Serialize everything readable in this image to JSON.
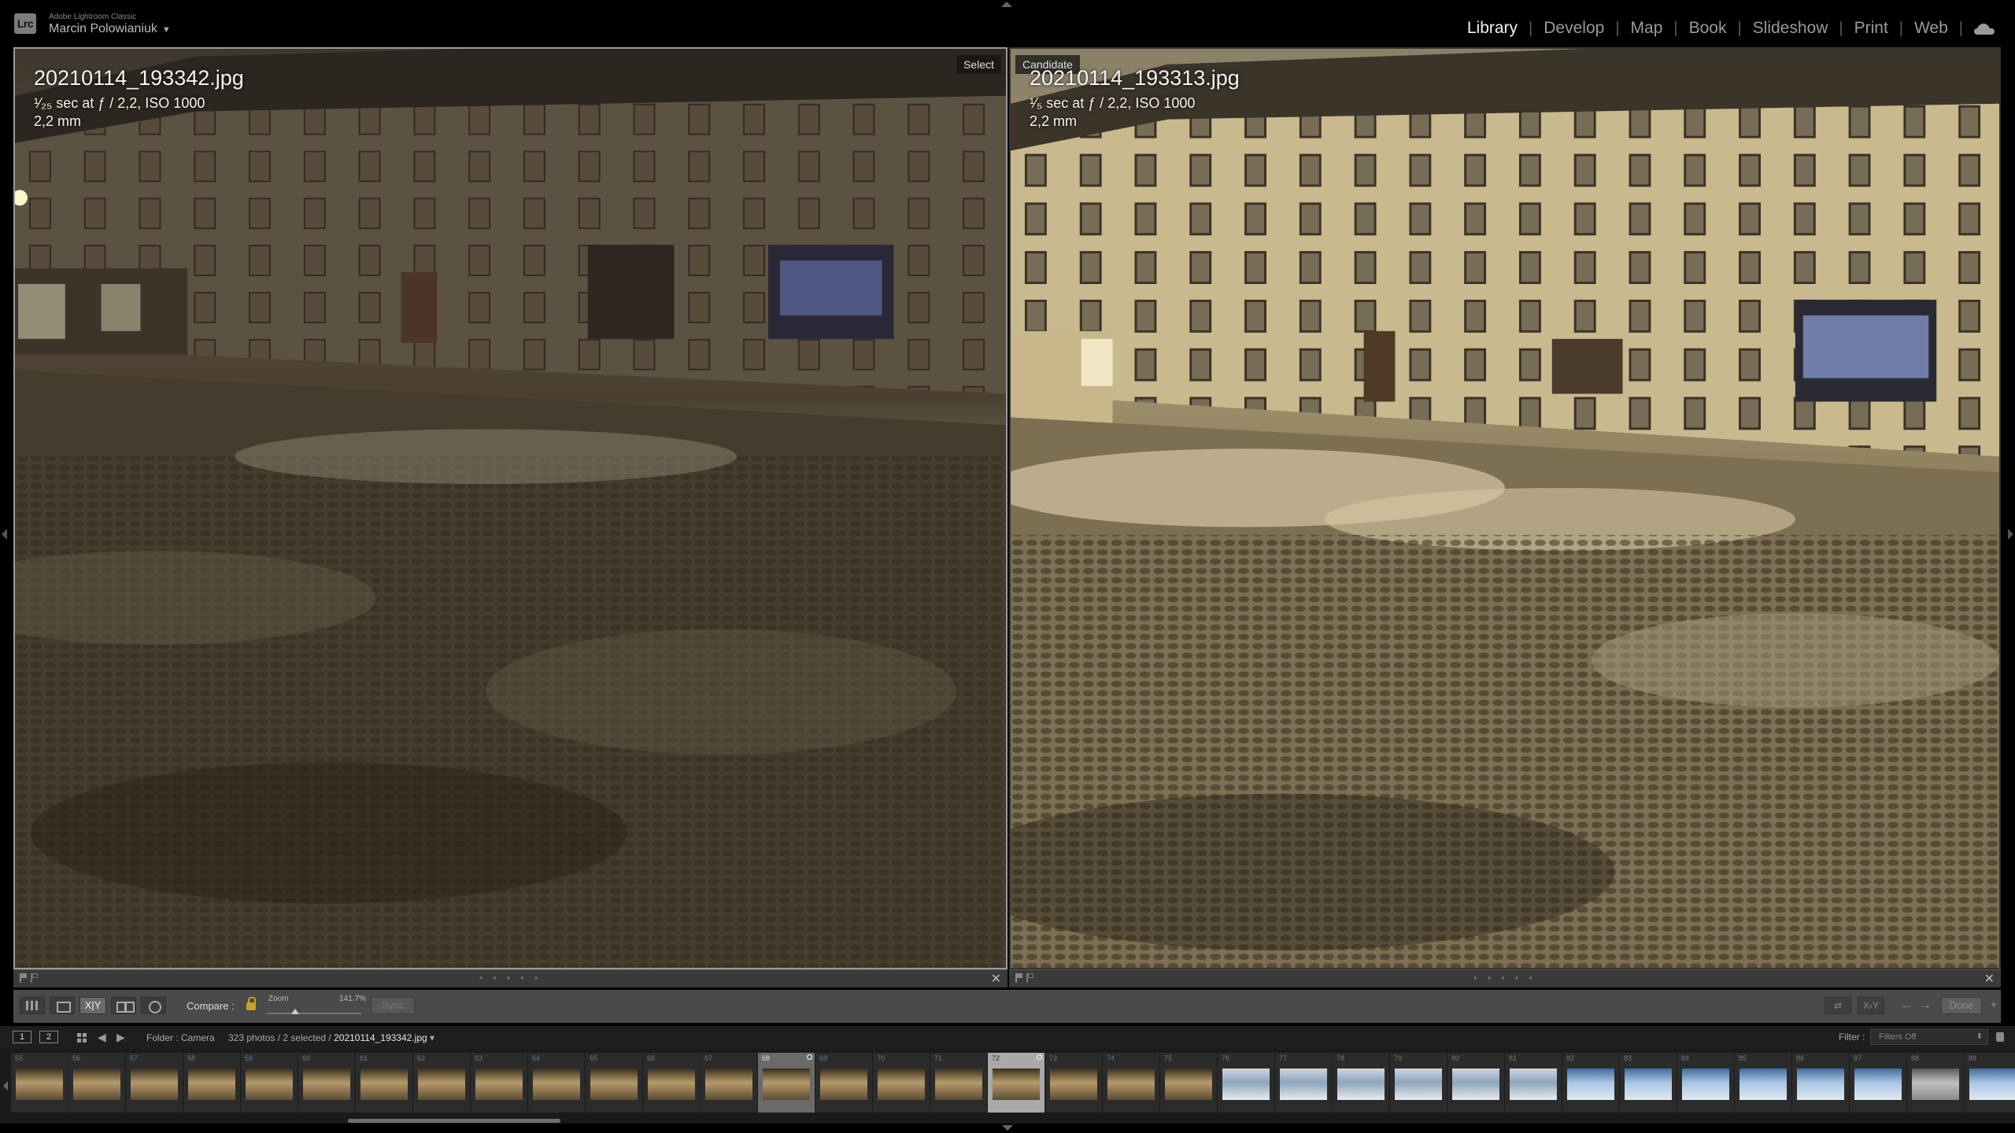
{
  "header": {
    "logo": "Lrc",
    "app_name": "Adobe Lightroom Classic",
    "user": "Marcin Polowianiuk",
    "modules": [
      {
        "label": "Library",
        "active": true
      },
      {
        "label": "Develop",
        "active": false
      },
      {
        "label": "Map",
        "active": false
      },
      {
        "label": "Book",
        "active": false
      },
      {
        "label": "Slideshow",
        "active": false
      },
      {
        "label": "Print",
        "active": false
      },
      {
        "label": "Web",
        "active": false
      }
    ]
  },
  "compare": {
    "select": {
      "tag": "Select",
      "filename": "20210114_193342.jpg",
      "exposure": "¹⁄₂₅ sec at ƒ / 2,2, ISO 1000",
      "focal": "2,2 mm"
    },
    "candidate": {
      "tag": "Candidate",
      "filename": "20210114_193313.jpg",
      "exposure": "¹⁄₅ sec at ƒ / 2,2, ISO 1000",
      "focal": "2,2 mm"
    }
  },
  "toolbar": {
    "compare_btn": "X|Y",
    "compare_label": "Compare :",
    "zoom_label": "Zoom",
    "zoom_value": "141.7%",
    "zoom_level": 0.3,
    "sync_label": "Sync",
    "done_label": "Done"
  },
  "filmstrip": {
    "monitor1": "1",
    "monitor2": "2",
    "source": "Folder : Camera",
    "count": "323 photos / 2 selected /",
    "current_file": "20210114_193342.jpg",
    "filter_label": "Filter :",
    "filter_value": "Filters Off",
    "thumbnails": [
      {
        "num": "55",
        "tone": "warm",
        "state": ""
      },
      {
        "num": "56",
        "tone": "warm",
        "state": ""
      },
      {
        "num": "57",
        "tone": "warm",
        "state": ""
      },
      {
        "num": "58",
        "tone": "warm",
        "state": ""
      },
      {
        "num": "59",
        "tone": "warm",
        "state": ""
      },
      {
        "num": "60",
        "tone": "warm",
        "state": ""
      },
      {
        "num": "61",
        "tone": "warm",
        "state": ""
      },
      {
        "num": "62",
        "tone": "warm",
        "state": ""
      },
      {
        "num": "63",
        "tone": "warm",
        "state": ""
      },
      {
        "num": "64",
        "tone": "warm",
        "state": ""
      },
      {
        "num": "65",
        "tone": "warm",
        "state": ""
      },
      {
        "num": "66",
        "tone": "warm",
        "state": ""
      },
      {
        "num": "67",
        "tone": "warm",
        "state": ""
      },
      {
        "num": "68",
        "tone": "warm",
        "state": "sel"
      },
      {
        "num": "69",
        "tone": "warm",
        "state": ""
      },
      {
        "num": "70",
        "tone": "warm",
        "state": ""
      },
      {
        "num": "71",
        "tone": "warm",
        "state": ""
      },
      {
        "num": "72",
        "tone": "warm",
        "state": "cand"
      },
      {
        "num": "73",
        "tone": "warm",
        "state": ""
      },
      {
        "num": "74",
        "tone": "warm",
        "state": ""
      },
      {
        "num": "75",
        "tone": "warm",
        "state": ""
      },
      {
        "num": "76",
        "tone": "snow",
        "state": ""
      },
      {
        "num": "77",
        "tone": "snow",
        "state": ""
      },
      {
        "num": "78",
        "tone": "snow",
        "state": ""
      },
      {
        "num": "79",
        "tone": "snow",
        "state": ""
      },
      {
        "num": "80",
        "tone": "snow",
        "state": ""
      },
      {
        "num": "81",
        "tone": "snow",
        "state": ""
      },
      {
        "num": "82",
        "tone": "blue",
        "state": ""
      },
      {
        "num": "83",
        "tone": "blue",
        "state": ""
      },
      {
        "num": "84",
        "tone": "blue",
        "state": ""
      },
      {
        "num": "85",
        "tone": "blue",
        "state": ""
      },
      {
        "num": "86",
        "tone": "blue",
        "state": ""
      },
      {
        "num": "87",
        "tone": "blue",
        "state": ""
      },
      {
        "num": "88",
        "tone": "grey",
        "state": ""
      },
      {
        "num": "89",
        "tone": "blue",
        "state": ""
      }
    ]
  },
  "colors": {
    "active_module": "#f2f2f2",
    "inactive_module": "#9a9a9a",
    "lock": "#c9a227"
  }
}
